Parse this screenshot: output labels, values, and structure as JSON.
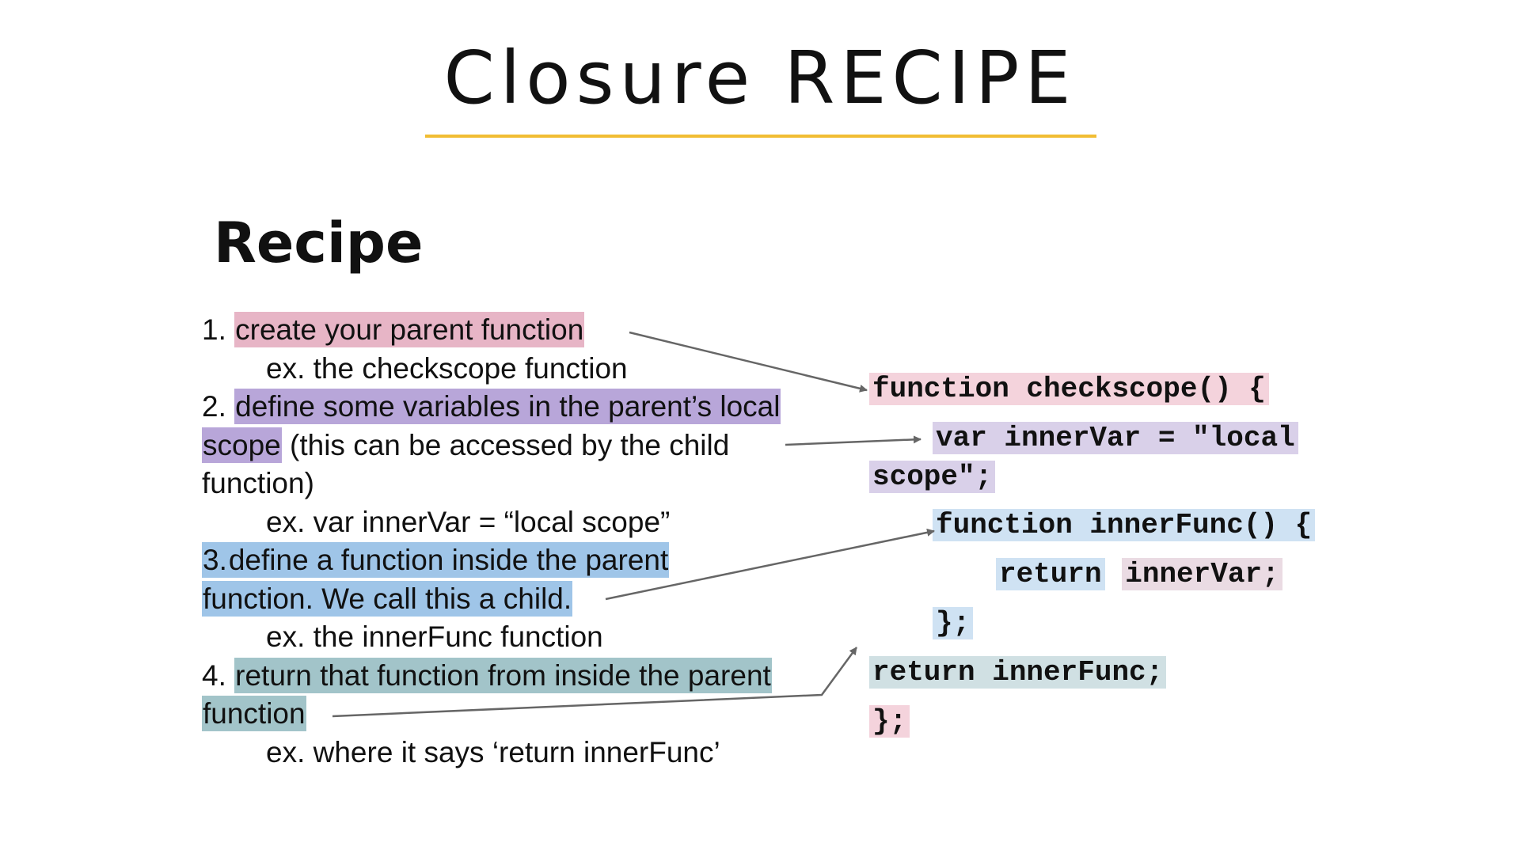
{
  "slide": {
    "title": "Closure RECIPE",
    "heading": "Recipe",
    "accent_color": "#f1bd33"
  },
  "steps": {
    "s1_num": "1.",
    "s1_hl": "create your parent function",
    "s1_ex": "ex. the checkscope function",
    "s2_num": "2.",
    "s2_hl_a": "define some variables in the parent’s local",
    "s2_hl_b": "scope",
    "s2_rest": " (this can be accessed by the child",
    "s2_rest2": "function)",
    "s2_ex": "ex. var innerVar = “local scope”",
    "s3_num": "3.",
    "s3_hl_a": "define a function inside the parent",
    "s3_hl_b": "function. We call this a child.",
    "s3_ex": "ex. the innerFunc function",
    "s4_num": "4.",
    "s4_hl_a": "return that function from inside the parent",
    "s4_hl_b": "function",
    "s4_ex": "ex. where it says ‘return innerFunc’"
  },
  "code": {
    "l1": "function checkscope() {",
    "l2": "var innerVar = \"local",
    "l3": "scope\";",
    "l4": "function innerFunc() {",
    "l5a": "return",
    "l5b": "innerVar;",
    "l6": "};",
    "l7": "return innerFunc;",
    "l8": "};"
  },
  "colors": {
    "pink": "#e7b5c6",
    "purple": "#b8a6d9",
    "blue": "#9fc5e8",
    "teal": "#a2c4c9"
  }
}
